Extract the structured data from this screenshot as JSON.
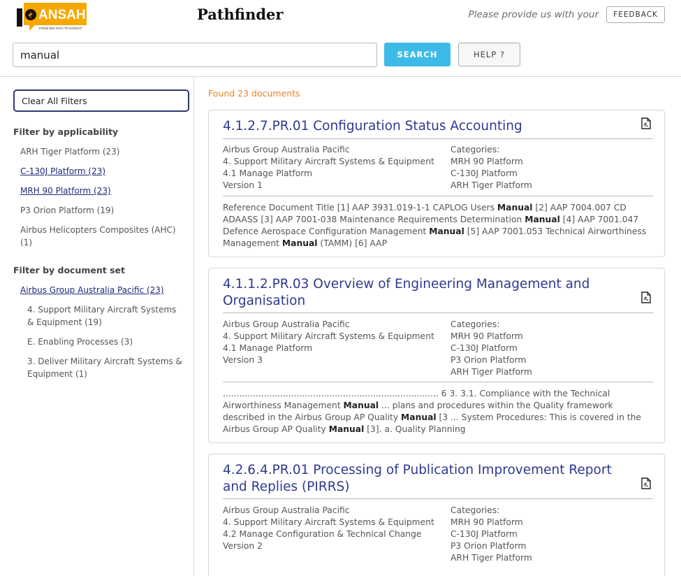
{
  "logo": {
    "text": "ANSAH",
    "tagline": "FROM BIG DATA TO INSIGHT"
  },
  "app_title": "Pathfinder",
  "feedback": {
    "prompt": "Please provide us with your",
    "button": "FEEDBACK"
  },
  "search": {
    "value": "manual",
    "button": "SEARCH",
    "help": "HELP ?"
  },
  "sidebar": {
    "clear_filters": "Clear All Filters",
    "applicability_heading": "Filter by applicability",
    "applicability": [
      "ARH Tiger Platform (23)",
      "C-130J Platform (23)",
      "MRH 90 Platform (23)",
      "P3 Orion Platform (19)",
      "Airbus Helicopters Composites (AHC) (1)"
    ],
    "docset_heading": "Filter by document set",
    "docset": [
      "Airbus Group Australia Pacific (23)",
      "4. Support Military Aircraft Systems & Equipment (19)",
      "E. Enabling Processes (3)",
      "3. Deliver Military Aircraft Systems & Equipment (1)"
    ]
  },
  "results": {
    "found": "Found 23 documents",
    "docs": [
      {
        "title": "4.1.2.7.PR.01 Configuration Status Accounting",
        "meta": [
          "Airbus Group Australia Pacific",
          "4. Support Military Aircraft Systems & Equipment",
          "4.1 Manage Platform",
          "Version 1"
        ],
        "categories_label": "Categories:",
        "categories": [
          "MRH 90 Platform",
          "C-130J Platform",
          "ARH Tiger Platform"
        ],
        "snippet": [
          "Reference Document Title [1] AAP 3931.019-1-1 CAPLOG Users ",
          "Manual",
          " [2] AAP 7004.007 CD ADAASS [3] AAP 7001-038 Maintenance Requirements Determination ",
          "Manual",
          " [4] AAP 7001.047 Defence Aerospace Configuration Management ",
          "Manual",
          " [5] AAP 7001.053 Technical Airworthiness Management ",
          "Manual",
          " (TAMM) [6] AAP"
        ]
      },
      {
        "title": "4.1.1.2.PR.03 Overview of Engineering Management and Organisation",
        "meta": [
          "Airbus Group Australia Pacific",
          "4. Support Military Aircraft Systems & Equipment",
          "4.1 Manage Platform",
          "Version 3"
        ],
        "categories_label": "Categories:",
        "categories": [
          "MRH 90 Platform",
          "C-130J Platform",
          "P3 Orion Platform",
          "ARH Tiger Platform"
        ],
        "snippet": [
          "............................................................................... 6 3. 3.1. Compliance with the Technical Airworthiness Management ",
          "Manual",
          " ... plans and procedures within the Quality framework described in the Airbus Group AP Quality ",
          "Manual",
          " [3 ... System Procedures: This is covered in the Airbus Group AP Quality ",
          "Manual",
          " [3]. a. Quality Planning"
        ]
      },
      {
        "title": "4.2.6.4.PR.01 Processing of Publication Improvement Report and Replies (PIRRS)",
        "meta": [
          "Airbus Group Australia Pacific",
          "4. Support Military Aircraft Systems & Equipment",
          "4.2 Manage Configuration & Technical Change",
          "Version 2"
        ],
        "categories_label": "Categories:",
        "categories": [
          "MRH 90 Platform",
          "C-130J Platform",
          "P3 Orion Platform",
          "ARH Tiger Platform"
        ],
        "snippet": []
      }
    ]
  },
  "colors": {
    "accent": "#3dbbe8",
    "title_link": "#2e3a8e",
    "found": "#e8822c",
    "logo": "#f6a800"
  }
}
